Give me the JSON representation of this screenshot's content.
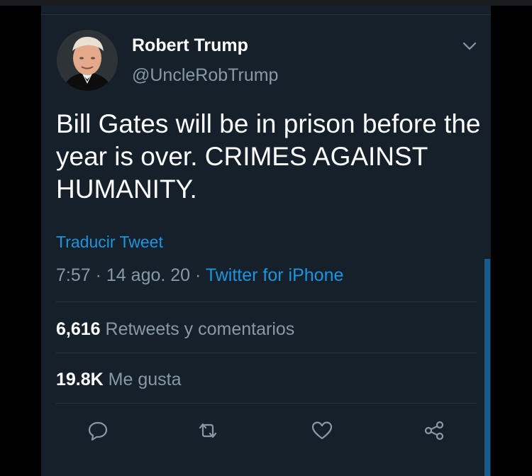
{
  "tweet": {
    "author_name": "Robert Trump",
    "author_handle": "@UncleRobTrump",
    "text": "Bill Gates will be in prison before the year is over. CRIMES AGAINST HUMANITY.",
    "translate_link": "Traducir Tweet",
    "time": "7:57",
    "date": "14 ago. 20",
    "separator": "·",
    "source": "Twitter for iPhone"
  },
  "stats": {
    "retweets_count": "6,616",
    "retweets_label": "Retweets y comentarios",
    "likes_count": "19.8K",
    "likes_label": "Me gusta"
  },
  "icons": {
    "menu": "chevron-down-icon",
    "reply": "reply-icon",
    "retweet": "retweet-icon",
    "like": "heart-icon",
    "share": "share-icon"
  },
  "colors": {
    "background": "#15202b",
    "accent": "#1b95e0",
    "muted": "#8899a6",
    "text": "#ffffff"
  }
}
